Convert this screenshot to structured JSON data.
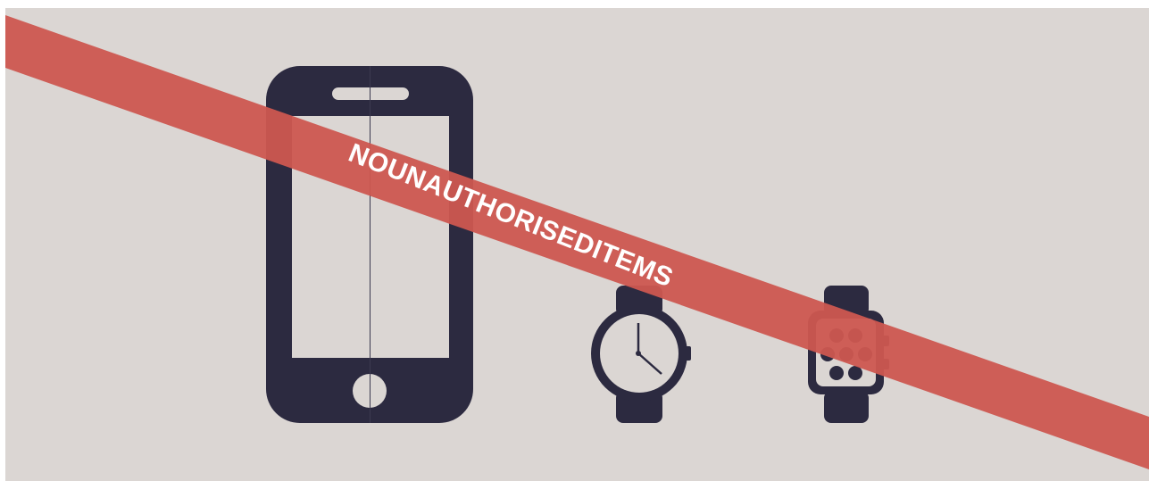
{
  "banner": {
    "text": "NOUNAUTHORISEDITEMS",
    "color": "#cd5750"
  },
  "items": [
    {
      "name": "smartphone-icon"
    },
    {
      "name": "wristwatch-icon"
    },
    {
      "name": "smartwatch-icon"
    }
  ],
  "colors": {
    "background": "#dbd6d3",
    "icon": "#2c2a40",
    "banner": "#cd5750",
    "text": "#ffffff"
  }
}
